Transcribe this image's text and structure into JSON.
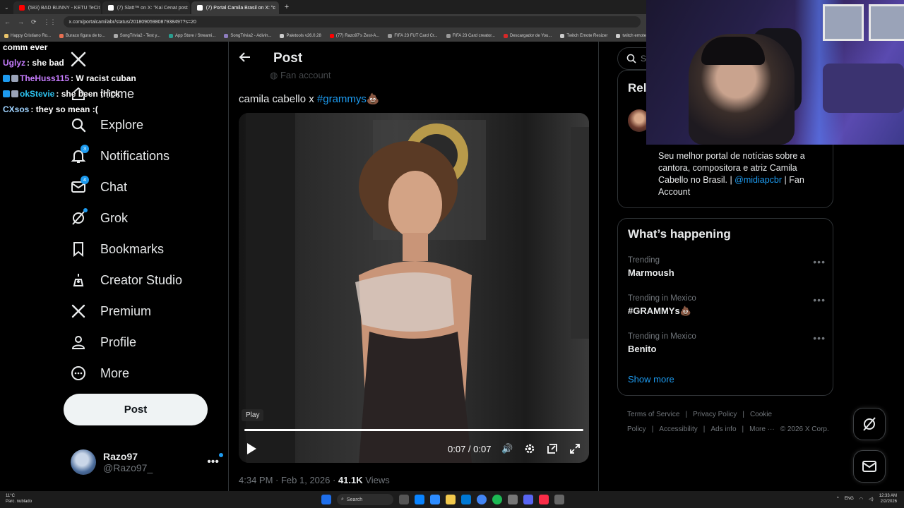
{
  "browser": {
    "tabs": [
      {
        "title": "(583) BAD BUNNY - KETU TeCit",
        "color": "#ff0000"
      },
      {
        "title": "(7) Slatt™ on X: \"Kai Cenat post",
        "color": "#ffffff"
      },
      {
        "title": "(7) Portal Camila Brasil on X: \"c",
        "color": "#ffffff"
      }
    ],
    "url": "x.com/portalcamilabr/status/2018090598087938497?s=20",
    "bookmarks": [
      {
        "label": "Happy Cristiano Ro...",
        "color": "#e9c46a"
      },
      {
        "label": "Buraco figura de to...",
        "color": "#e76f51"
      },
      {
        "label": "SongTrivia2 - Test y...",
        "color": "#aaaaaa"
      },
      {
        "label": "App Store / Streami...",
        "color": "#2a9d8f"
      },
      {
        "label": "SongTrivia2 - Adivin...",
        "color": "#8e7dbe"
      },
      {
        "label": "Paletools v26.0.28",
        "color": "#cccccc"
      },
      {
        "label": "(77) Razo97's Zest-A...",
        "color": "#ff0000"
      },
      {
        "label": "FIFA 23 FUT Card Cr...",
        "color": "#999999"
      },
      {
        "label": "FIFA 23 Card creator...",
        "color": "#999999"
      },
      {
        "label": "Descargador de You...",
        "color": "#d62828"
      },
      {
        "label": "Twitch Emote Resizer",
        "color": "#cccccc"
      },
      {
        "label": "twitch emote re...",
        "color": "#cccccc"
      }
    ]
  },
  "chat": [
    {
      "user": "",
      "msg": "comm ever",
      "color": "#ffffff"
    },
    {
      "user": "Uglyz",
      "msg": ": she bad",
      "color": "#c77dff"
    },
    {
      "user": "TheHuss115",
      "msg": ": W racist cuban",
      "color": "#c77dff"
    },
    {
      "user": "okStevie",
      "msg": ": she been thick",
      "color": "#2ec4f1"
    },
    {
      "user": "CXsos",
      "msg": ": they so mean :(",
      "color": "#9fd3ff"
    }
  ],
  "nav": {
    "home": "Home",
    "explore": "Explore",
    "notifications": "Notifications",
    "notifications_badge": "3",
    "chat": "Chat",
    "chat_badge": "4",
    "grok": "Grok",
    "bookmarks": "Bookmarks",
    "creator_studio": "Creator Studio",
    "premium": "Premium",
    "profile": "Profile",
    "more": "More",
    "post": "Post"
  },
  "user": {
    "name": "Razo97",
    "handle": "@Razo97_"
  },
  "post": {
    "header": "Post",
    "fan_account_peek": "Fan account",
    "text": "camila cabello x ",
    "hashtag": "#grammys",
    "hashtag_emoji": "💩",
    "video": {
      "play_tooltip": "Play",
      "time": "0:07 / 0:07",
      "progress": 1.0
    },
    "time": "4:34 PM",
    "date": "Feb 1, 2026",
    "views_count": "41.1K",
    "views_label": "Views"
  },
  "right": {
    "search_placeholder": "Se",
    "relevant_title": "Rel",
    "relevant_bio": "Seu melhor portal de notícias sobre a cantora, compositora e atriz Camila Cabello no Brasil. | ",
    "relevant_mention": "@midiapcbr",
    "relevant_bio_end": " | Fan Account",
    "whats_happening": "What’s happening",
    "trends": [
      {
        "context": "Trending",
        "name": "Marmoush"
      },
      {
        "context": "Trending in Mexico",
        "name": "#GRAMMYs💩"
      },
      {
        "context": "Trending in Mexico",
        "name": "Benito"
      }
    ],
    "show_more": "Show more",
    "footer": [
      "Terms of Service",
      "|",
      "Privacy Policy",
      "|",
      "Cookie Policy",
      "|",
      "Accessibility",
      "|",
      "Ads info",
      "|",
      "More ···",
      "© 2026 X Corp."
    ]
  },
  "taskbar": {
    "temp": "11°C",
    "weather": "Parc. nublado",
    "search": "Search",
    "lang": "ENG",
    "time": "12:33 AM",
    "date": "2/2/2026"
  },
  "colors": {
    "accent": "#1d9bf0",
    "bg": "#000000",
    "border": "#2f3336",
    "muted": "#71767b"
  }
}
